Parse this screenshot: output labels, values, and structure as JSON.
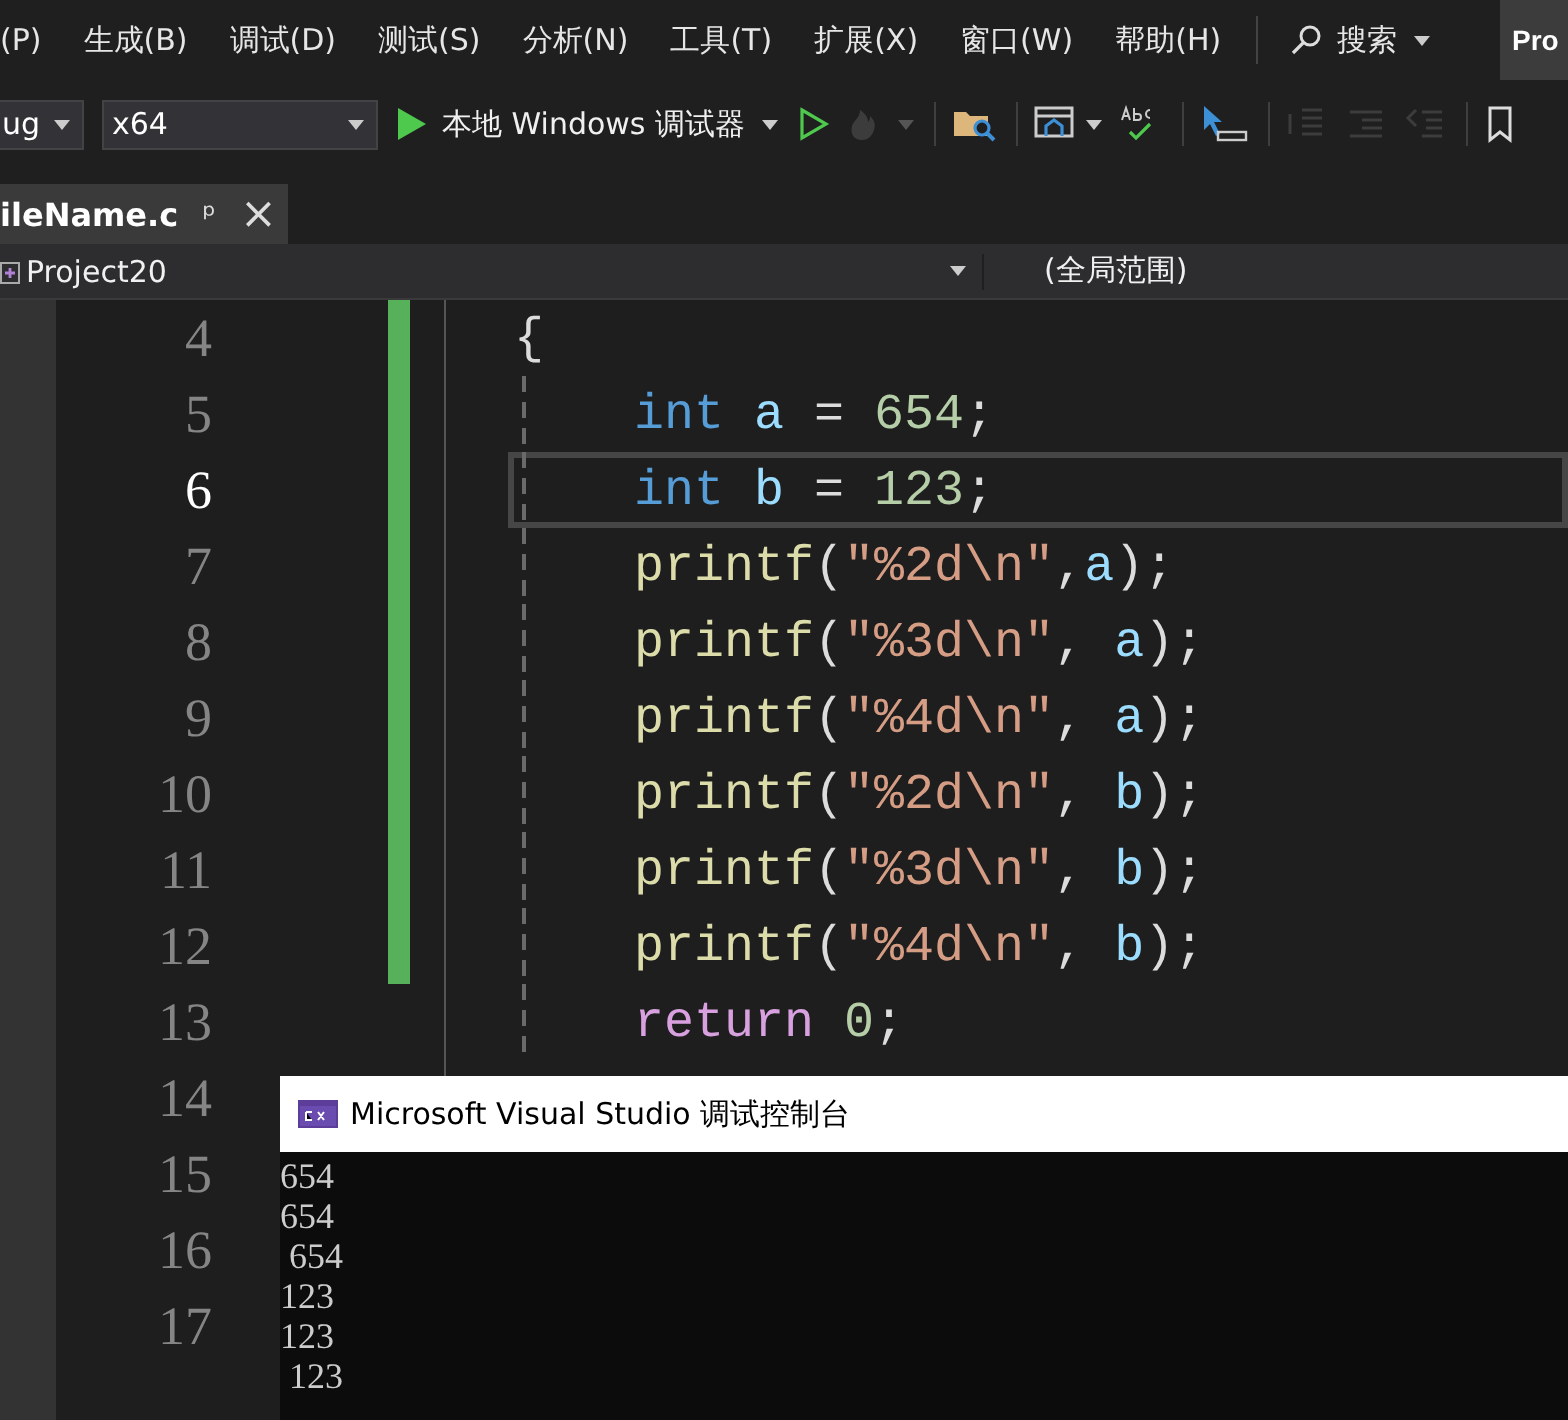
{
  "menu_bar": {
    "items": [
      {
        "label": "(P)"
      },
      {
        "label": "生成(B)"
      },
      {
        "label": "调试(D)"
      },
      {
        "label": "测试(S)"
      },
      {
        "label": "分析(N)"
      },
      {
        "label": "工具(T)"
      },
      {
        "label": "扩展(X)"
      },
      {
        "label": "窗口(W)"
      },
      {
        "label": "帮助(H)"
      }
    ],
    "search": {
      "label": "搜索"
    },
    "project_button": {
      "label": "Pro"
    }
  },
  "toolbar": {
    "configuration": {
      "value": "ug"
    },
    "platform": {
      "value": "x64"
    },
    "debug_button": {
      "label": "本地 Windows 调试器"
    },
    "buttons": [
      {
        "kind": "run",
        "disabled": false
      },
      {
        "kind": "hot-reload",
        "disabled": true
      },
      {
        "kind": "find-files",
        "disabled": false
      },
      {
        "kind": "layout",
        "disabled": false
      },
      {
        "kind": "spell",
        "disabled": false
      },
      {
        "kind": "select",
        "disabled": false
      },
      {
        "kind": "outdent",
        "disabled": true
      },
      {
        "kind": "indent",
        "disabled": true
      },
      {
        "kind": "uncomment",
        "disabled": true
      },
      {
        "kind": "bookmark",
        "disabled": false
      }
    ]
  },
  "tabs": [
    {
      "label": "ileName.c",
      "selected": true,
      "pin": "ᵖ",
      "close": "×"
    }
  ],
  "nav_bar": {
    "project": "Project20",
    "scope": "(全局范围)"
  },
  "editor": {
    "lines": [
      {
        "number": "4",
        "current": false,
        "changed": true,
        "indented": false,
        "tokens": [
          {
            "kind": "punct",
            "text": "{"
          }
        ]
      },
      {
        "number": "5",
        "current": false,
        "changed": true,
        "indented": true,
        "tokens": [
          {
            "kind": "keyword",
            "text": "int "
          },
          {
            "kind": "ident",
            "text": "a"
          },
          {
            "kind": "punct",
            "text": " = "
          },
          {
            "kind": "number",
            "text": "654"
          },
          {
            "kind": "punct",
            "text": ";"
          }
        ]
      },
      {
        "number": "6",
        "current": true,
        "changed": true,
        "indented": true,
        "tokens": [
          {
            "kind": "keyword",
            "text": "int "
          },
          {
            "kind": "ident",
            "text": "b"
          },
          {
            "kind": "punct",
            "text": " = "
          },
          {
            "kind": "number",
            "text": "123"
          },
          {
            "kind": "punct",
            "text": ";"
          }
        ]
      },
      {
        "number": "7",
        "current": false,
        "changed": true,
        "indented": true,
        "tokens": [
          {
            "kind": "function",
            "text": "printf"
          },
          {
            "kind": "punct",
            "text": "("
          },
          {
            "kind": "string",
            "text": "\"%2d\\n\""
          },
          {
            "kind": "punct",
            "text": ","
          },
          {
            "kind": "ident",
            "text": "a"
          },
          {
            "kind": "punct",
            "text": ");"
          }
        ]
      },
      {
        "number": "8",
        "current": false,
        "changed": true,
        "indented": true,
        "tokens": [
          {
            "kind": "function",
            "text": "printf"
          },
          {
            "kind": "punct",
            "text": "("
          },
          {
            "kind": "string",
            "text": "\"%3d\\n\""
          },
          {
            "kind": "punct",
            "text": ", "
          },
          {
            "kind": "ident",
            "text": "a"
          },
          {
            "kind": "punct",
            "text": ");"
          }
        ]
      },
      {
        "number": "9",
        "current": false,
        "changed": true,
        "indented": true,
        "tokens": [
          {
            "kind": "function",
            "text": "printf"
          },
          {
            "kind": "punct",
            "text": "("
          },
          {
            "kind": "string",
            "text": "\"%4d\\n\""
          },
          {
            "kind": "punct",
            "text": ", "
          },
          {
            "kind": "ident",
            "text": "a"
          },
          {
            "kind": "punct",
            "text": ");"
          }
        ]
      },
      {
        "number": "10",
        "current": false,
        "changed": true,
        "indented": true,
        "tokens": [
          {
            "kind": "function",
            "text": "printf"
          },
          {
            "kind": "punct",
            "text": "("
          },
          {
            "kind": "string",
            "text": "\"%2d\\n\""
          },
          {
            "kind": "punct",
            "text": ", "
          },
          {
            "kind": "ident",
            "text": "b"
          },
          {
            "kind": "punct",
            "text": ");"
          }
        ]
      },
      {
        "number": "11",
        "current": false,
        "changed": true,
        "indented": true,
        "tokens": [
          {
            "kind": "function",
            "text": "printf"
          },
          {
            "kind": "punct",
            "text": "("
          },
          {
            "kind": "string",
            "text": "\"%3d\\n\""
          },
          {
            "kind": "punct",
            "text": ", "
          },
          {
            "kind": "ident",
            "text": "b"
          },
          {
            "kind": "punct",
            "text": ");"
          }
        ]
      },
      {
        "number": "12",
        "current": false,
        "changed": true,
        "indented": true,
        "tokens": [
          {
            "kind": "function",
            "text": "printf"
          },
          {
            "kind": "punct",
            "text": "("
          },
          {
            "kind": "string",
            "text": "\"%4d\\n\""
          },
          {
            "kind": "punct",
            "text": ", "
          },
          {
            "kind": "ident",
            "text": "b"
          },
          {
            "kind": "punct",
            "text": ");"
          }
        ]
      },
      {
        "number": "13",
        "current": false,
        "changed": false,
        "indented": true,
        "tokens": [
          {
            "kind": "control",
            "text": "return "
          },
          {
            "kind": "number",
            "text": "0"
          },
          {
            "kind": "punct",
            "text": ";"
          }
        ]
      },
      {
        "number": "14",
        "current": false,
        "changed": false
      },
      {
        "number": "15",
        "current": false,
        "changed": false
      },
      {
        "number": "16",
        "current": false,
        "changed": false
      },
      {
        "number": "17",
        "current": false,
        "changed": false
      }
    ]
  },
  "console": {
    "title": "Microsoft Visual Studio 调试控制台",
    "output": [
      "654",
      "654",
      " 654",
      "123",
      "123",
      " 123"
    ]
  }
}
